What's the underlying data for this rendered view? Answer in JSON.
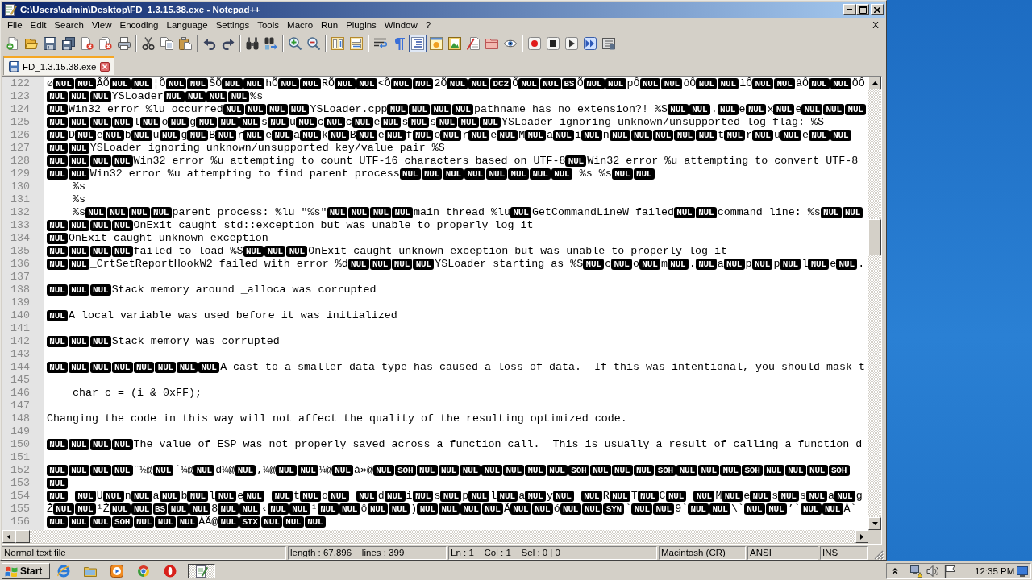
{
  "window": {
    "title": "C:\\Users\\admin\\Desktop\\FD_1.3.15.38.exe - Notepad++"
  },
  "menu": {
    "items": [
      "File",
      "Edit",
      "Search",
      "View",
      "Encoding",
      "Language",
      "Settings",
      "Tools",
      "Macro",
      "Run",
      "Plugins",
      "Window",
      "?"
    ],
    "close": "X"
  },
  "toolbar": [
    {
      "buttons": [
        {
          "on": false
        },
        {
          "on": false
        },
        {
          "on": false
        },
        {
          "on": false
        },
        {
          "on": false
        },
        {
          "on": false
        },
        {
          "on": false
        }
      ]
    },
    {
      "buttons": [
        {
          "on": false
        },
        {
          "on": false
        },
        {
          "on": false
        }
      ]
    },
    {
      "buttons": [
        {
          "on": false
        },
        {
          "on": false
        }
      ]
    },
    {
      "buttons": [
        {
          "on": false
        },
        {
          "on": false
        }
      ]
    },
    {
      "buttons": [
        {
          "on": false
        },
        {
          "on": false
        }
      ]
    },
    {
      "buttons": [
        {
          "on": false
        },
        {
          "on": false
        }
      ]
    },
    {
      "buttons": [
        {
          "on": false
        },
        {
          "on": false
        },
        {
          "on": true
        },
        {
          "on": false
        },
        {
          "on": false
        },
        {
          "on": false
        },
        {
          "on": false
        },
        {
          "on": false
        }
      ]
    },
    {
      "buttons": [
        {
          "on": false
        },
        {
          "on": false
        },
        {
          "on": false
        },
        {
          "on": false
        },
        {
          "on": false
        }
      ]
    }
  ],
  "tabs": [
    {
      "label": "FD_1.3.15.38.exe",
      "selected": true
    }
  ],
  "editor": {
    "lines": [
      {
        "number": "122",
        "segments": [
          {
            "kind": "text",
            "text": "ø"
          },
          {
            "kind": "ctrl",
            "codes": [
              "NUL",
              "NUL"
            ]
          },
          {
            "kind": "text",
            "text": "ÂÕ"
          },
          {
            "kind": "ctrl",
            "codes": [
              "NUL",
              "NUL"
            ]
          },
          {
            "kind": "text",
            "text": "¦Õ"
          },
          {
            "kind": "ctrl",
            "codes": [
              "NUL",
              "NUL"
            ]
          },
          {
            "kind": "text",
            "text": "ŠÕ"
          },
          {
            "kind": "ctrl",
            "codes": [
              "NUL",
              "NUL"
            ]
          },
          {
            "kind": "text",
            "text": "hÕ"
          },
          {
            "kind": "ctrl",
            "codes": [
              "NUL",
              "NUL"
            ]
          },
          {
            "kind": "text",
            "text": "RÕ"
          },
          {
            "kind": "ctrl",
            "codes": [
              "NUL",
              "NUL"
            ]
          },
          {
            "kind": "text",
            "text": "<Õ"
          },
          {
            "kind": "ctrl",
            "codes": [
              "NUL",
              "NUL"
            ]
          },
          {
            "kind": "text",
            "text": "2Õ"
          },
          {
            "kind": "ctrl",
            "codes": [
              "NUL",
              "NUL",
              "DC2"
            ]
          },
          {
            "kind": "text",
            "text": "Õ"
          },
          {
            "kind": "ctrl",
            "codes": [
              "NUL",
              "NUL",
              "BS"
            ]
          },
          {
            "kind": "text",
            "text": "Õ"
          },
          {
            "kind": "ctrl",
            "codes": [
              "NUL",
              "NUL"
            ]
          },
          {
            "kind": "text",
            "text": "pÔ"
          },
          {
            "kind": "ctrl",
            "codes": [
              "NUL",
              "NUL"
            ]
          },
          {
            "kind": "text",
            "text": "ôÔ"
          },
          {
            "kind": "ctrl",
            "codes": [
              "NUL",
              "NUL"
            ]
          },
          {
            "kind": "text",
            "text": "ìÔ"
          },
          {
            "kind": "ctrl",
            "codes": [
              "NUL",
              "NUL"
            ]
          },
          {
            "kind": "text",
            "text": "âÔ"
          },
          {
            "kind": "ctrl",
            "codes": [
              "NUL",
              "NUL"
            ]
          },
          {
            "kind": "text",
            "text": "ÖÔ"
          }
        ]
      },
      {
        "number": "123",
        "segments": [
          {
            "kind": "ctrl",
            "codes": [
              "NUL",
              "NUL",
              "NUL"
            ]
          },
          {
            "kind": "text",
            "text": "YSLoader"
          },
          {
            "kind": "ctrl",
            "codes": [
              "NUL",
              "NUL",
              "NUL",
              "NUL"
            ]
          },
          {
            "kind": "text",
            "text": "%s"
          }
        ]
      },
      {
        "number": "124",
        "segments": [
          {
            "kind": "ctrl",
            "codes": [
              "NUL"
            ]
          },
          {
            "kind": "text",
            "text": "Win32 error %lu occurred"
          },
          {
            "kind": "ctrl",
            "codes": [
              "NUL",
              "NUL",
              "NUL",
              "NUL"
            ]
          },
          {
            "kind": "text",
            "text": "YSLoader.cpp"
          },
          {
            "kind": "ctrl",
            "codes": [
              "NUL",
              "NUL",
              "NUL",
              "NUL"
            ]
          },
          {
            "kind": "text",
            "text": "pathname has no extension?! %S"
          },
          {
            "kind": "ctrl",
            "codes": [
              "NUL",
              "NUL"
            ]
          },
          {
            "kind": "text",
            "text": "."
          },
          {
            "kind": "ctrl",
            "codes": [
              "NUL"
            ]
          },
          {
            "kind": "text",
            "text": "e"
          },
          {
            "kind": "ctrl",
            "codes": [
              "NUL"
            ]
          },
          {
            "kind": "text",
            "text": "x"
          },
          {
            "kind": "ctrl",
            "codes": [
              "NUL"
            ]
          },
          {
            "kind": "text",
            "text": "e"
          },
          {
            "kind": "ctrl",
            "codes": [
              "NUL",
              "NUL",
              "NUL"
            ]
          }
        ]
      },
      {
        "number": "125",
        "segments": [
          {
            "kind": "ctrl",
            "codes": [
              "NUL",
              "NUL",
              "NUL",
              "NUL"
            ]
          },
          {
            "kind": "text",
            "text": "l"
          },
          {
            "kind": "ctrl",
            "codes": [
              "NUL"
            ]
          },
          {
            "kind": "text",
            "text": "o"
          },
          {
            "kind": "ctrl",
            "codes": [
              "NUL"
            ]
          },
          {
            "kind": "text",
            "text": "g"
          },
          {
            "kind": "ctrl",
            "codes": [
              "NUL",
              "NUL",
              "NUL"
            ]
          },
          {
            "kind": "text",
            "text": "s"
          },
          {
            "kind": "ctrl",
            "codes": [
              "NUL"
            ]
          },
          {
            "kind": "text",
            "text": "u"
          },
          {
            "kind": "ctrl",
            "codes": [
              "NUL"
            ]
          },
          {
            "kind": "text",
            "text": "c"
          },
          {
            "kind": "ctrl",
            "codes": [
              "NUL"
            ]
          },
          {
            "kind": "text",
            "text": "c"
          },
          {
            "kind": "ctrl",
            "codes": [
              "NUL"
            ]
          },
          {
            "kind": "text",
            "text": "e"
          },
          {
            "kind": "ctrl",
            "codes": [
              "NUL"
            ]
          },
          {
            "kind": "text",
            "text": "s"
          },
          {
            "kind": "ctrl",
            "codes": [
              "NUL"
            ]
          },
          {
            "kind": "text",
            "text": "s"
          },
          {
            "kind": "ctrl",
            "codes": [
              "NUL",
              "NUL",
              "NUL"
            ]
          },
          {
            "kind": "text",
            "text": "YSLoader ignoring unknown/unsupported log flag: %S"
          }
        ]
      },
      {
        "number": "126",
        "segments": [
          {
            "kind": "ctrl",
            "codes": [
              "NUL"
            ]
          },
          {
            "kind": "text",
            "text": "D"
          },
          {
            "kind": "ctrl",
            "codes": [
              "NUL"
            ]
          },
          {
            "kind": "text",
            "text": "e"
          },
          {
            "kind": "ctrl",
            "codes": [
              "NUL"
            ]
          },
          {
            "kind": "text",
            "text": "b"
          },
          {
            "kind": "ctrl",
            "codes": [
              "NUL"
            ]
          },
          {
            "kind": "text",
            "text": "u"
          },
          {
            "kind": "ctrl",
            "codes": [
              "NUL"
            ]
          },
          {
            "kind": "text",
            "text": "g"
          },
          {
            "kind": "ctrl",
            "codes": [
              "NUL"
            ]
          },
          {
            "kind": "text",
            "text": "B"
          },
          {
            "kind": "ctrl",
            "codes": [
              "NUL"
            ]
          },
          {
            "kind": "text",
            "text": "r"
          },
          {
            "kind": "ctrl",
            "codes": [
              "NUL"
            ]
          },
          {
            "kind": "text",
            "text": "e"
          },
          {
            "kind": "ctrl",
            "codes": [
              "NUL"
            ]
          },
          {
            "kind": "text",
            "text": "a"
          },
          {
            "kind": "ctrl",
            "codes": [
              "NUL"
            ]
          },
          {
            "kind": "text",
            "text": "k"
          },
          {
            "kind": "ctrl",
            "codes": [
              "NUL"
            ]
          },
          {
            "kind": "text",
            "text": "B"
          },
          {
            "kind": "ctrl",
            "codes": [
              "NUL"
            ]
          },
          {
            "kind": "text",
            "text": "e"
          },
          {
            "kind": "ctrl",
            "codes": [
              "NUL"
            ]
          },
          {
            "kind": "text",
            "text": "f"
          },
          {
            "kind": "ctrl",
            "codes": [
              "NUL"
            ]
          },
          {
            "kind": "text",
            "text": "o"
          },
          {
            "kind": "ctrl",
            "codes": [
              "NUL"
            ]
          },
          {
            "kind": "text",
            "text": "r"
          },
          {
            "kind": "ctrl",
            "codes": [
              "NUL"
            ]
          },
          {
            "kind": "text",
            "text": "e"
          },
          {
            "kind": "ctrl",
            "codes": [
              "NUL"
            ]
          },
          {
            "kind": "text",
            "text": "M"
          },
          {
            "kind": "ctrl",
            "codes": [
              "NUL"
            ]
          },
          {
            "kind": "text",
            "text": "a"
          },
          {
            "kind": "ctrl",
            "codes": [
              "NUL"
            ]
          },
          {
            "kind": "text",
            "text": "i"
          },
          {
            "kind": "ctrl",
            "codes": [
              "NUL"
            ]
          },
          {
            "kind": "text",
            "text": "n"
          },
          {
            "kind": "ctrl",
            "codes": [
              "NUL",
              "NUL",
              "NUL",
              "NUL",
              "NUL"
            ]
          },
          {
            "kind": "text",
            "text": "t"
          },
          {
            "kind": "ctrl",
            "codes": [
              "NUL"
            ]
          },
          {
            "kind": "text",
            "text": "r"
          },
          {
            "kind": "ctrl",
            "codes": [
              "NUL"
            ]
          },
          {
            "kind": "text",
            "text": "u"
          },
          {
            "kind": "ctrl",
            "codes": [
              "NUL"
            ]
          },
          {
            "kind": "text",
            "text": "e"
          },
          {
            "kind": "ctrl",
            "codes": [
              "NUL",
              "NUL"
            ]
          }
        ]
      },
      {
        "number": "127",
        "segments": [
          {
            "kind": "ctrl",
            "codes": [
              "NUL",
              "NUL"
            ]
          },
          {
            "kind": "text",
            "text": "YSLoader ignoring unknown/unsupported key/value pair %S"
          }
        ]
      },
      {
        "number": "128",
        "segments": [
          {
            "kind": "ctrl",
            "codes": [
              "NUL",
              "NUL",
              "NUL",
              "NUL"
            ]
          },
          {
            "kind": "text",
            "text": "Win32 error %u attempting to count UTF-16 characters based on UTF-8"
          },
          {
            "kind": "ctrl",
            "codes": [
              "NUL"
            ]
          },
          {
            "kind": "text",
            "text": "Win32 error %u attempting to convert UTF-8"
          }
        ]
      },
      {
        "number": "129",
        "segments": [
          {
            "kind": "ctrl",
            "codes": [
              "NUL",
              "NUL"
            ]
          },
          {
            "kind": "text",
            "text": "Win32 error %u attempting to find parent process"
          },
          {
            "kind": "ctrl",
            "codes": [
              "NUL",
              "NUL",
              "NUL",
              "NUL",
              "NUL",
              "NUL",
              "NUL",
              "NUL"
            ]
          },
          {
            "kind": "text",
            "text": " %s %s"
          },
          {
            "kind": "ctrl",
            "codes": [
              "NUL",
              "NUL"
            ]
          }
        ]
      },
      {
        "number": "130",
        "segments": [
          {
            "kind": "text",
            "text": "    %s"
          }
        ]
      },
      {
        "number": "131",
        "segments": [
          {
            "kind": "text",
            "text": "    %s"
          }
        ]
      },
      {
        "number": "132",
        "segments": [
          {
            "kind": "text",
            "text": "    %s"
          },
          {
            "kind": "ctrl",
            "codes": [
              "NUL",
              "NUL",
              "NUL",
              "NUL"
            ]
          },
          {
            "kind": "text",
            "text": "parent process: %lu \"%s\""
          },
          {
            "kind": "ctrl",
            "codes": [
              "NUL",
              "NUL",
              "NUL",
              "NUL"
            ]
          },
          {
            "kind": "text",
            "text": "main thread %lu"
          },
          {
            "kind": "ctrl",
            "codes": [
              "NUL"
            ]
          },
          {
            "kind": "text",
            "text": "GetCommandLineW failed"
          },
          {
            "kind": "ctrl",
            "codes": [
              "NUL",
              "NUL"
            ]
          },
          {
            "kind": "text",
            "text": "command line: %s"
          },
          {
            "kind": "ctrl",
            "codes": [
              "NUL",
              "NUL"
            ]
          }
        ]
      },
      {
        "number": "133",
        "segments": [
          {
            "kind": "ctrl",
            "codes": [
              "NUL",
              "NUL",
              "NUL",
              "NUL"
            ]
          },
          {
            "kind": "text",
            "text": "OnExit caught std::exception but was unable to properly log it"
          }
        ]
      },
      {
        "number": "134",
        "segments": [
          {
            "kind": "ctrl",
            "codes": [
              "NUL"
            ]
          },
          {
            "kind": "text",
            "text": "OnExit caught unknown exception"
          }
        ]
      },
      {
        "number": "135",
        "segments": [
          {
            "kind": "ctrl",
            "codes": [
              "NUL",
              "NUL",
              "NUL",
              "NUL"
            ]
          },
          {
            "kind": "text",
            "text": "failed to load %S"
          },
          {
            "kind": "ctrl",
            "codes": [
              "NUL",
              "NUL",
              "NUL"
            ]
          },
          {
            "kind": "text",
            "text": "OnExit caught unknown exception but was unable to properly log it"
          }
        ]
      },
      {
        "number": "136",
        "segments": [
          {
            "kind": "ctrl",
            "codes": [
              "NUL",
              "NUL"
            ]
          },
          {
            "kind": "text",
            "text": "_CrtSetReportHookW2 failed with error %d"
          },
          {
            "kind": "ctrl",
            "codes": [
              "NUL",
              "NUL",
              "NUL",
              "NUL"
            ]
          },
          {
            "kind": "text",
            "text": "YSLoader starting as %S"
          },
          {
            "kind": "ctrl",
            "codes": [
              "NUL"
            ]
          },
          {
            "kind": "text",
            "text": "c"
          },
          {
            "kind": "ctrl",
            "codes": [
              "NUL"
            ]
          },
          {
            "kind": "text",
            "text": "o"
          },
          {
            "kind": "ctrl",
            "codes": [
              "NUL"
            ]
          },
          {
            "kind": "text",
            "text": "m"
          },
          {
            "kind": "ctrl",
            "codes": [
              "NUL"
            ]
          },
          {
            "kind": "text",
            "text": "."
          },
          {
            "kind": "ctrl",
            "codes": [
              "NUL"
            ]
          },
          {
            "kind": "text",
            "text": "a"
          },
          {
            "kind": "ctrl",
            "codes": [
              "NUL"
            ]
          },
          {
            "kind": "text",
            "text": "p"
          },
          {
            "kind": "ctrl",
            "codes": [
              "NUL"
            ]
          },
          {
            "kind": "text",
            "text": "p"
          },
          {
            "kind": "ctrl",
            "codes": [
              "NUL"
            ]
          },
          {
            "kind": "text",
            "text": "l"
          },
          {
            "kind": "ctrl",
            "codes": [
              "NUL"
            ]
          },
          {
            "kind": "text",
            "text": "e"
          },
          {
            "kind": "ctrl",
            "codes": [
              "NUL"
            ]
          },
          {
            "kind": "text",
            "text": "."
          }
        ]
      },
      {
        "number": "137"
      },
      {
        "number": "138",
        "segments": [
          {
            "kind": "ctrl",
            "codes": [
              "NUL",
              "NUL",
              "NUL"
            ]
          },
          {
            "kind": "text",
            "text": "Stack memory around _alloca was corrupted"
          }
        ]
      },
      {
        "number": "139"
      },
      {
        "number": "140",
        "segments": [
          {
            "kind": "ctrl",
            "codes": [
              "NUL"
            ]
          },
          {
            "kind": "text",
            "text": "A local variable was used before it was initialized"
          }
        ]
      },
      {
        "number": "141"
      },
      {
        "number": "142",
        "segments": [
          {
            "kind": "ctrl",
            "codes": [
              "NUL",
              "NUL",
              "NUL"
            ]
          },
          {
            "kind": "text",
            "text": "Stack memory was corrupted"
          }
        ]
      },
      {
        "number": "143"
      },
      {
        "number": "144",
        "segments": [
          {
            "kind": "ctrl",
            "codes": [
              "NUL",
              "NUL",
              "NUL",
              "NUL",
              "NUL",
              "NUL",
              "NUL",
              "NUL"
            ]
          },
          {
            "kind": "text",
            "text": "A cast to a smaller data type has caused a loss of data.  If this was intentional, you should mask t"
          }
        ]
      },
      {
        "number": "145"
      },
      {
        "number": "146",
        "segments": [
          {
            "kind": "text",
            "text": "    char c = (i & 0xFF);"
          }
        ]
      },
      {
        "number": "147"
      },
      {
        "number": "148",
        "segments": [
          {
            "kind": "text",
            "text": "Changing the code in this way will not affect the quality of the resulting optimized code."
          }
        ]
      },
      {
        "number": "149"
      },
      {
        "number": "150",
        "segments": [
          {
            "kind": "ctrl",
            "codes": [
              "NUL",
              "NUL",
              "NUL",
              "NUL"
            ]
          },
          {
            "kind": "text",
            "text": "The value of ESP was not properly saved across a function call.  This is usually a result of calling a function d"
          }
        ]
      },
      {
        "number": "151"
      },
      {
        "number": "152",
        "segments": [
          {
            "kind": "ctrl",
            "codes": [
              "NUL",
              "NUL",
              "NUL",
              "NUL"
            ]
          },
          {
            "kind": "text",
            "text": "¨½@"
          },
          {
            "kind": "ctrl",
            "codes": [
              "NUL"
            ]
          },
          {
            "kind": "text",
            "text": "ˆ¼@"
          },
          {
            "kind": "ctrl",
            "codes": [
              "NUL"
            ]
          },
          {
            "kind": "text",
            "text": "d¼@"
          },
          {
            "kind": "ctrl",
            "codes": [
              "NUL"
            ]
          },
          {
            "kind": "text",
            "text": ",¼@"
          },
          {
            "kind": "ctrl",
            "codes": [
              "NUL",
              "NUL"
            ]
          },
          {
            "kind": "text",
            "text": "¼@"
          },
          {
            "kind": "ctrl",
            "codes": [
              "NUL"
            ]
          },
          {
            "kind": "text",
            "text": "à»@"
          },
          {
            "kind": "ctrl",
            "codes": [
              "NUL",
              "SOH",
              "NUL",
              "NUL",
              "NUL",
              "NUL",
              "NUL",
              "NUL",
              "NUL",
              "SOH",
              "NUL",
              "NUL",
              "NUL",
              "SOH",
              "NUL",
              "NUL",
              "NUL",
              "SOH",
              "NUL",
              "NUL",
              "NUL",
              "SOH"
            ]
          }
        ]
      },
      {
        "number": "153",
        "segments": [
          {
            "kind": "ctrl",
            "codes": [
              "NUL"
            ]
          }
        ]
      },
      {
        "number": "154",
        "segments": [
          {
            "kind": "ctrl",
            "codes": [
              "NUL"
            ]
          },
          {
            "kind": "space"
          },
          {
            "kind": "ctrl",
            "codes": [
              "NUL"
            ]
          },
          {
            "kind": "text",
            "text": "U"
          },
          {
            "kind": "ctrl",
            "codes": [
              "NUL"
            ]
          },
          {
            "kind": "text",
            "text": "n"
          },
          {
            "kind": "ctrl",
            "codes": [
              "NUL"
            ]
          },
          {
            "kind": "text",
            "text": "a"
          },
          {
            "kind": "ctrl",
            "codes": [
              "NUL"
            ]
          },
          {
            "kind": "text",
            "text": "b"
          },
          {
            "kind": "ctrl",
            "codes": [
              "NUL"
            ]
          },
          {
            "kind": "text",
            "text": "l"
          },
          {
            "kind": "ctrl",
            "codes": [
              "NUL"
            ]
          },
          {
            "kind": "text",
            "text": "e"
          },
          {
            "kind": "ctrl",
            "codes": [
              "NUL"
            ]
          },
          {
            "kind": "space"
          },
          {
            "kind": "ctrl",
            "codes": [
              "NUL"
            ]
          },
          {
            "kind": "text",
            "text": "t"
          },
          {
            "kind": "ctrl",
            "codes": [
              "NUL"
            ]
          },
          {
            "kind": "text",
            "text": "o"
          },
          {
            "kind": "ctrl",
            "codes": [
              "NUL"
            ]
          },
          {
            "kind": "space"
          },
          {
            "kind": "ctrl",
            "codes": [
              "NUL"
            ]
          },
          {
            "kind": "text",
            "text": "d"
          },
          {
            "kind": "ctrl",
            "codes": [
              "NUL"
            ]
          },
          {
            "kind": "text",
            "text": "i"
          },
          {
            "kind": "ctrl",
            "codes": [
              "NUL"
            ]
          },
          {
            "kind": "text",
            "text": "s"
          },
          {
            "kind": "ctrl",
            "codes": [
              "NUL"
            ]
          },
          {
            "kind": "text",
            "text": "p"
          },
          {
            "kind": "ctrl",
            "codes": [
              "NUL"
            ]
          },
          {
            "kind": "text",
            "text": "l"
          },
          {
            "kind": "ctrl",
            "codes": [
              "NUL"
            ]
          },
          {
            "kind": "text",
            "text": "a"
          },
          {
            "kind": "ctrl",
            "codes": [
              "NUL"
            ]
          },
          {
            "kind": "text",
            "text": "y"
          },
          {
            "kind": "ctrl",
            "codes": [
              "NUL"
            ]
          },
          {
            "kind": "space"
          },
          {
            "kind": "ctrl",
            "codes": [
              "NUL"
            ]
          },
          {
            "kind": "text",
            "text": "R"
          },
          {
            "kind": "ctrl",
            "codes": [
              "NUL"
            ]
          },
          {
            "kind": "text",
            "text": "T"
          },
          {
            "kind": "ctrl",
            "codes": [
              "NUL"
            ]
          },
          {
            "kind": "text",
            "text": "C"
          },
          {
            "kind": "ctrl",
            "codes": [
              "NUL"
            ]
          },
          {
            "kind": "space"
          },
          {
            "kind": "ctrl",
            "codes": [
              "NUL"
            ]
          },
          {
            "kind": "text",
            "text": "M"
          },
          {
            "kind": "ctrl",
            "codes": [
              "NUL"
            ]
          },
          {
            "kind": "text",
            "text": "e"
          },
          {
            "kind": "ctrl",
            "codes": [
              "NUL"
            ]
          },
          {
            "kind": "text",
            "text": "s"
          },
          {
            "kind": "ctrl",
            "codes": [
              "NUL"
            ]
          },
          {
            "kind": "text",
            "text": "s"
          },
          {
            "kind": "ctrl",
            "codes": [
              "NUL"
            ]
          },
          {
            "kind": "text",
            "text": "a"
          },
          {
            "kind": "ctrl",
            "codes": [
              "NUL"
            ]
          },
          {
            "kind": "text",
            "text": "g"
          }
        ]
      },
      {
        "number": "155",
        "segments": [
          {
            "kind": "text",
            "text": "Ž"
          },
          {
            "kind": "ctrl",
            "codes": [
              "NUL",
              "NUL"
            ]
          },
          {
            "kind": "text",
            "text": "¹Ž"
          },
          {
            "kind": "ctrl",
            "codes": [
              "NUL",
              "NUL",
              "BS",
              "NUL",
              "NUL"
            ]
          },
          {
            "kind": "text",
            "text": "8"
          },
          {
            "kind": "ctrl",
            "codes": [
              "NUL",
              "NUL"
            ]
          },
          {
            "kind": "text",
            "text": "‹"
          },
          {
            "kind": "ctrl",
            "codes": [
              "NUL",
              "NUL"
            ]
          },
          {
            "kind": "text",
            "text": "¹"
          },
          {
            "kind": "ctrl",
            "codes": [
              "NUL",
              "NUL"
            ]
          },
          {
            "kind": "text",
            "text": "ô"
          },
          {
            "kind": "ctrl",
            "codes": [
              "NUL",
              "NUL"
            ]
          },
          {
            "kind": "text",
            "text": ")"
          },
          {
            "kind": "ctrl",
            "codes": [
              "NUL",
              "NUL",
              "NUL",
              "NUL"
            ]
          },
          {
            "kind": "text",
            "text": "Ã"
          },
          {
            "kind": "ctrl",
            "codes": [
              "NUL",
              "NUL"
            ]
          },
          {
            "kind": "text",
            "text": "ó"
          },
          {
            "kind": "ctrl",
            "codes": [
              "NUL",
              "NUL",
              "SYN"
            ]
          },
          {
            "kind": "text",
            "text": "`"
          },
          {
            "kind": "ctrl",
            "codes": [
              "NUL",
              "NUL"
            ]
          },
          {
            "kind": "text",
            "text": "9`"
          },
          {
            "kind": "ctrl",
            "codes": [
              "NUL",
              "NUL"
            ]
          },
          {
            "kind": "text",
            "text": "\\`"
          },
          {
            "kind": "ctrl",
            "codes": [
              "NUL",
              "NUL"
            ]
          },
          {
            "kind": "text",
            "text": "’`"
          },
          {
            "kind": "ctrl",
            "codes": [
              "NUL",
              "NUL"
            ]
          },
          {
            "kind": "text",
            "text": "À`"
          }
        ]
      },
      {
        "number": "156",
        "segments": [
          {
            "kind": "ctrl",
            "codes": [
              "NUL",
              "NUL",
              "NUL",
              "SOH",
              "NUL",
              "NUL",
              "NUL"
            ]
          },
          {
            "kind": "text",
            "text": "ÀÃ@"
          },
          {
            "kind": "ctrl",
            "codes": [
              "NUL",
              "STX",
              "NUL",
              "NUL",
              "NUL"
            ]
          }
        ]
      }
    ]
  },
  "status_bar": [
    "Normal text file",
    "length : 67,896    lines : 399",
    "Ln : 1    Col : 1    Sel : 0 | 0",
    "Macintosh (CR)",
    "ANSI",
    "INS"
  ],
  "taskbar": {
    "start": "Start",
    "windows": [
      {
        "selected": true
      }
    ],
    "clock": "12:35 PM"
  }
}
